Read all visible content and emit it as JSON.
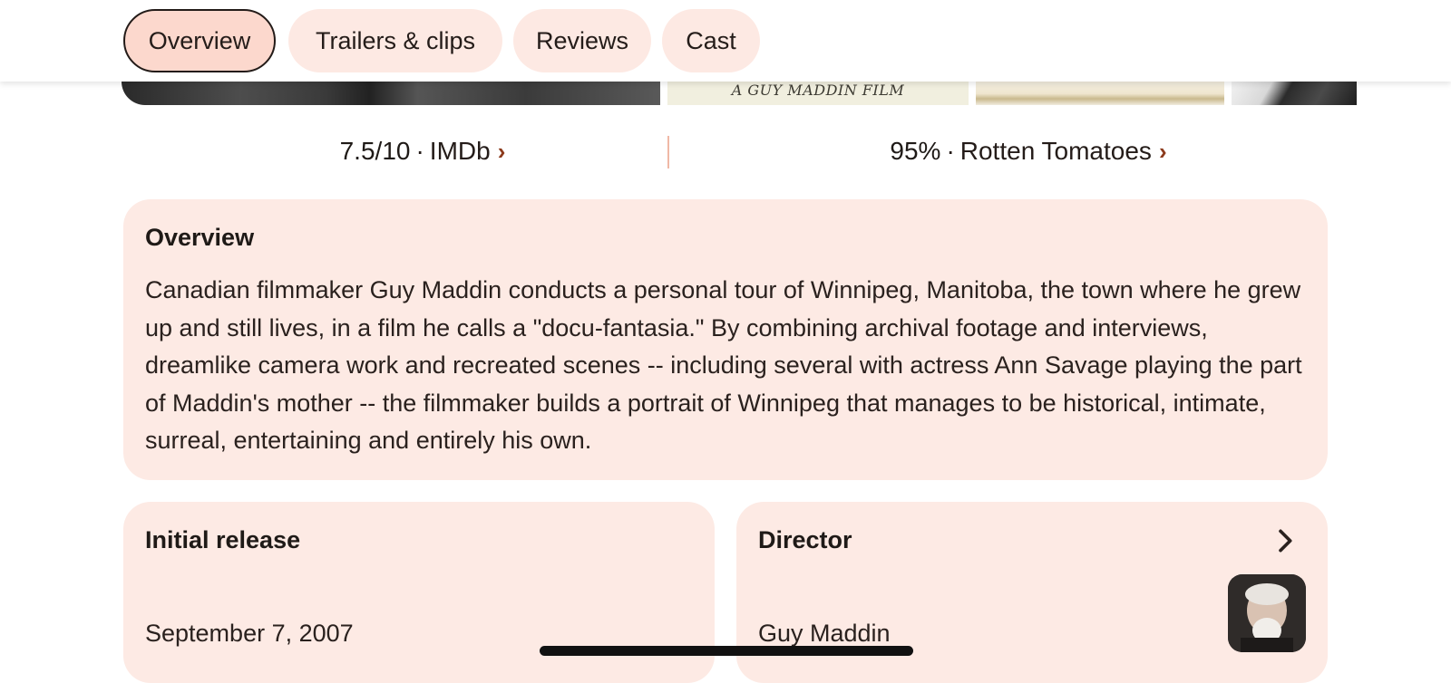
{
  "tabs": [
    {
      "label": "Overview",
      "active": true
    },
    {
      "label": "Trailers & clips",
      "active": false
    },
    {
      "label": "Reviews",
      "active": false
    },
    {
      "label": "Cast",
      "active": false
    }
  ],
  "media_strip": {
    "poster_caption": "A GUY MADDIN FILM"
  },
  "ratings": {
    "imdb": {
      "score": "7.5/10",
      "source": "IMDb"
    },
    "rotten_tomatoes": {
      "score": "95%",
      "source": "Rotten Tomatoes"
    },
    "separator": "·"
  },
  "overview": {
    "title": "Overview",
    "text": "Canadian filmmaker Guy Maddin conducts a personal tour of Winnipeg, Manitoba, the town where he grew up and still lives, in a film he calls a \"docu-fantasia.\" By combining archival footage and interviews, dreamlike camera work and recreated scenes -- including several with actress Ann Savage playing the part of Maddin's mother -- the filmmaker builds a portrait of Winnipeg that manages to be historical, intimate, surreal, entertaining and entirely his own."
  },
  "initial_release": {
    "title": "Initial release",
    "value": "September 7, 2007"
  },
  "director": {
    "title": "Director",
    "value": "Guy Maddin",
    "icon": "chevron-right-icon"
  },
  "colors": {
    "tab_bg": "#fde9e3",
    "tab_active_bg": "#fcd8cd",
    "card_bg": "#fdeae4",
    "accent": "#8c3a1c"
  }
}
